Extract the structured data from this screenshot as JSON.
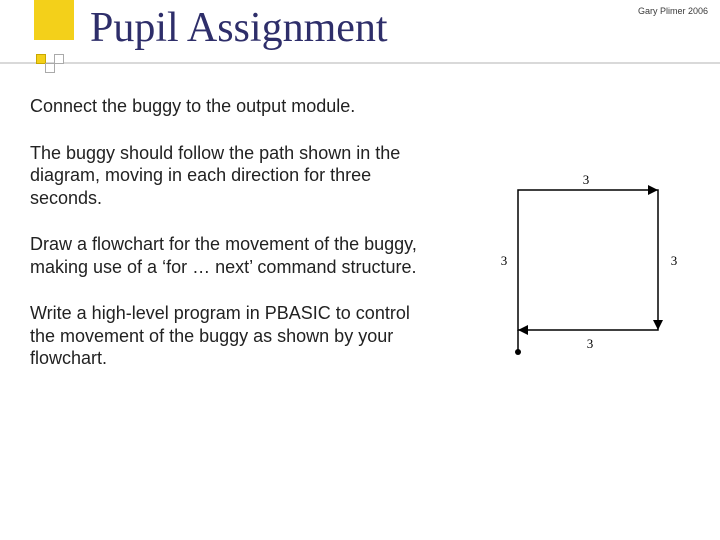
{
  "header": {
    "title": "Pupil Assignment",
    "attribution": "Gary Plimer 2006"
  },
  "body": {
    "p1": "Connect the buggy to the output module.",
    "p2": "The buggy should follow the path shown in the diagram, moving in each direction for three seconds.",
    "p3": "Draw a flowchart for the movement of the buggy, making use of a ‘for … next’ command structure.",
    "p4": "Write a high-level program in PBASIC to control the movement of the buggy as shown by your flowchart."
  },
  "diagram": {
    "label_top": "3",
    "label_left": "3",
    "label_right": "3",
    "label_bottom": "3"
  }
}
